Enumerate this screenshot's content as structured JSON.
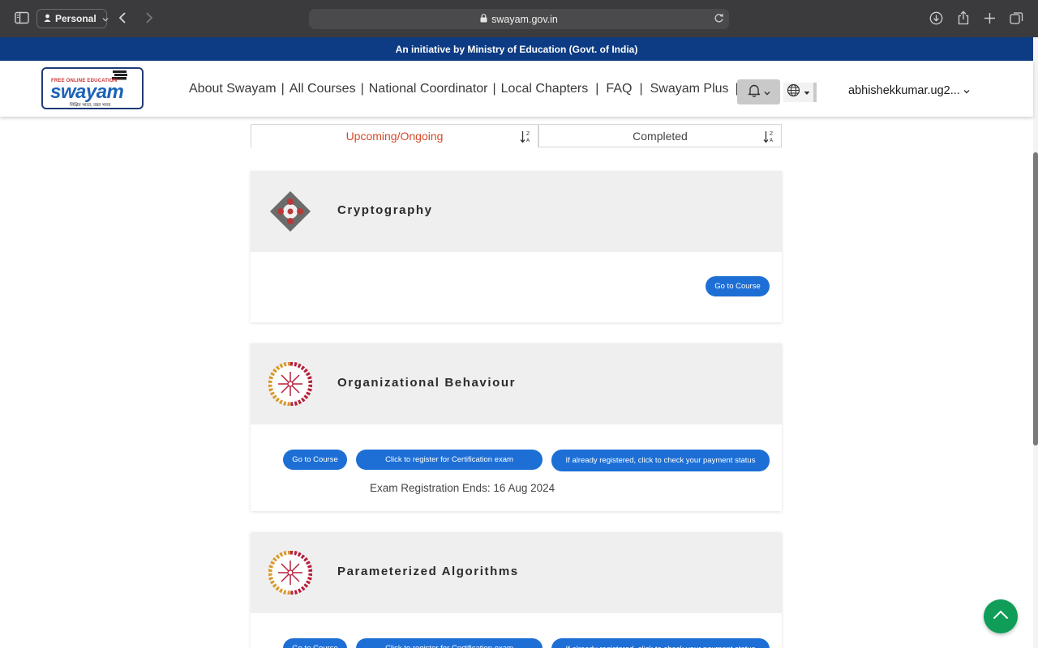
{
  "browser": {
    "profile_label": "Personal",
    "url": "swayam.gov.in"
  },
  "banner": {
    "text": "An initiative by Ministry of Education (Govt. of India)"
  },
  "header": {
    "logo": {
      "tagline": "FREE ONLINE EDUCATION",
      "wordmark": "swayam",
      "subtitle": "शिक्षित भारत, उन्नत भारत"
    },
    "nav": [
      "About Swayam",
      "All Courses",
      "National Coordinator",
      "Local Chapters",
      "FAQ",
      "Swayam Plus"
    ],
    "nav_separator": "|",
    "user_name": "abhishekkumar.ug2..."
  },
  "tabs": {
    "upcoming": "Upcoming/Ongoing",
    "completed": "Completed"
  },
  "courses": [
    {
      "title": "Cryptography",
      "go_label": "Go to Course"
    },
    {
      "title": "Organizational Behaviour",
      "go_label": "Go to Course",
      "register_label": "Click to register for Certification exam",
      "payment_label": "If already registered, click to check your payment status",
      "exam_ends": "Exam Registration Ends: 16 Aug 2024"
    },
    {
      "title": "Parameterized Algorithms",
      "go_label": "Go to Course",
      "register_label": "Click to register for Certification exam",
      "payment_label": "If already registered, click to check your payment status"
    }
  ],
  "colors": {
    "banner_bg": "#0d3c84",
    "active_tab": "#d44a2a",
    "button_blue": "#1d6fd6",
    "to_top_green": "#0f9d58"
  }
}
